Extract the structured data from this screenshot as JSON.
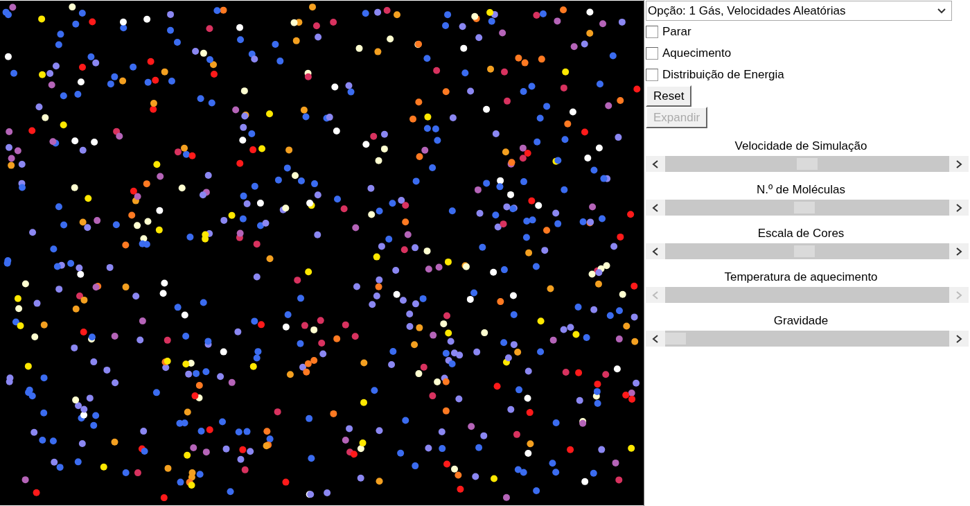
{
  "option_select": {
    "value": "Opção: 1 Gás, Velocidades Aleatórias"
  },
  "checkboxes": [
    {
      "label": "Parar",
      "checked": false
    },
    {
      "label": "Aquecimento",
      "checked": false
    },
    {
      "label": "Distribuição de Energia",
      "checked": false
    }
  ],
  "buttons": [
    {
      "label": "Reset",
      "disabled": false
    },
    {
      "label": "Expandir",
      "disabled": true
    }
  ],
  "sliders": [
    {
      "label": "Velocidade de Simulação",
      "level": 0.5,
      "disabled": false
    },
    {
      "label": "N.º de Moléculas",
      "level": 0.49,
      "disabled": false
    },
    {
      "label": "Escala de Cores",
      "level": 0.49,
      "disabled": false
    },
    {
      "label": "Temperatura de aquecimento",
      "disabled": true
    },
    {
      "label": "Gravidade",
      "level": 0.0,
      "disabled": false
    }
  ]
}
